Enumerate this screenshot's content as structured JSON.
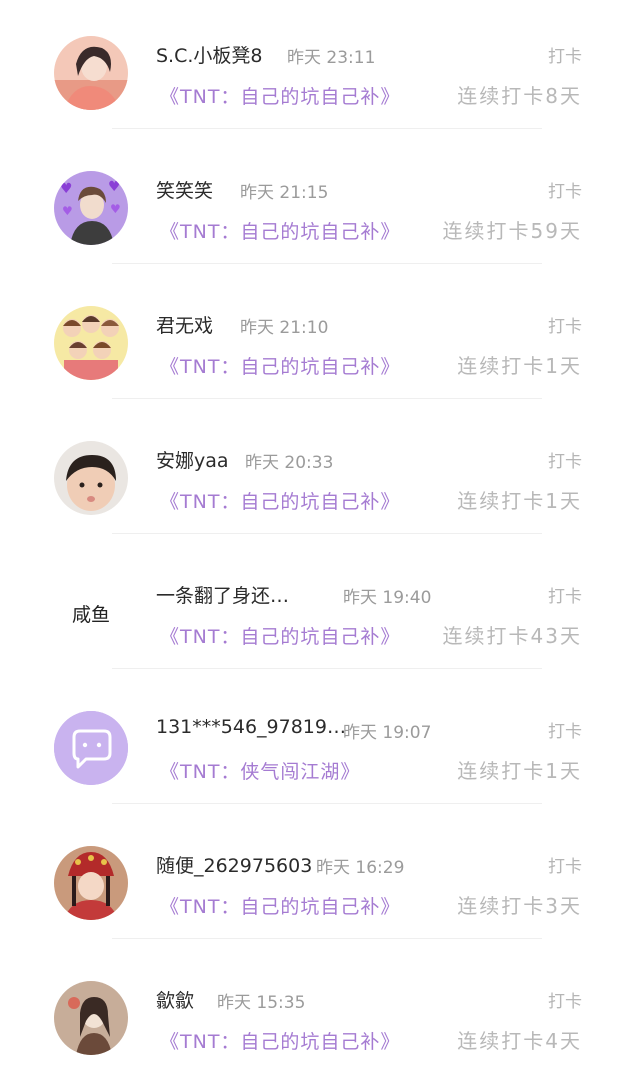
{
  "checkin_label": "打卡",
  "entries": [
    {
      "name": "S.C.小板凳8",
      "time": "昨天 23:11",
      "topic": "《TNT：自己的坑自己补》",
      "streak": "连续打卡8天",
      "avatar": "girl-portrait-avatar"
    },
    {
      "name": "笑笑笑",
      "time": "昨天 21:15",
      "topic": "《TNT：自己的坑自己补》",
      "streak": "连续打卡59天",
      "avatar": "boy-hearts-avatar"
    },
    {
      "name": "君无戏",
      "time": "昨天 21:10",
      "topic": "《TNT：自己的坑自己补》",
      "streak": "连续打卡1天",
      "avatar": "cartoon-group-avatar"
    },
    {
      "name": "安娜yaa",
      "time": "昨天 20:33",
      "topic": "《TNT：自己的坑自己补》",
      "streak": "连续打卡1天",
      "avatar": "boy-face-avatar"
    },
    {
      "name": "一条翻了身还…",
      "time": "昨天 19:40",
      "topic": "《TNT：自己的坑自己补》",
      "streak": "连续打卡43天",
      "avatar": "text-avatar",
      "avatar_text": "咸鱼"
    },
    {
      "name": "131***546_97819…",
      "time": "昨天 19:07",
      "topic": "《TNT：侠气闯江湖》",
      "streak": "连续打卡1天",
      "avatar": "default-chat-avatar"
    },
    {
      "name": "随便_262975603",
      "time": "昨天 16:29",
      "topic": "《TNT：自己的坑自己补》",
      "streak": "连续打卡3天",
      "avatar": "opera-headdress-avatar"
    },
    {
      "name": "歙歙",
      "time": "昨天 15:35",
      "topic": "《TNT：自己的坑自己补》",
      "streak": "连续打卡4天",
      "avatar": "drawn-girl-avatar"
    }
  ],
  "colors": {
    "accent": "#a57bd2",
    "avatar_default": "#c9b3ef"
  }
}
